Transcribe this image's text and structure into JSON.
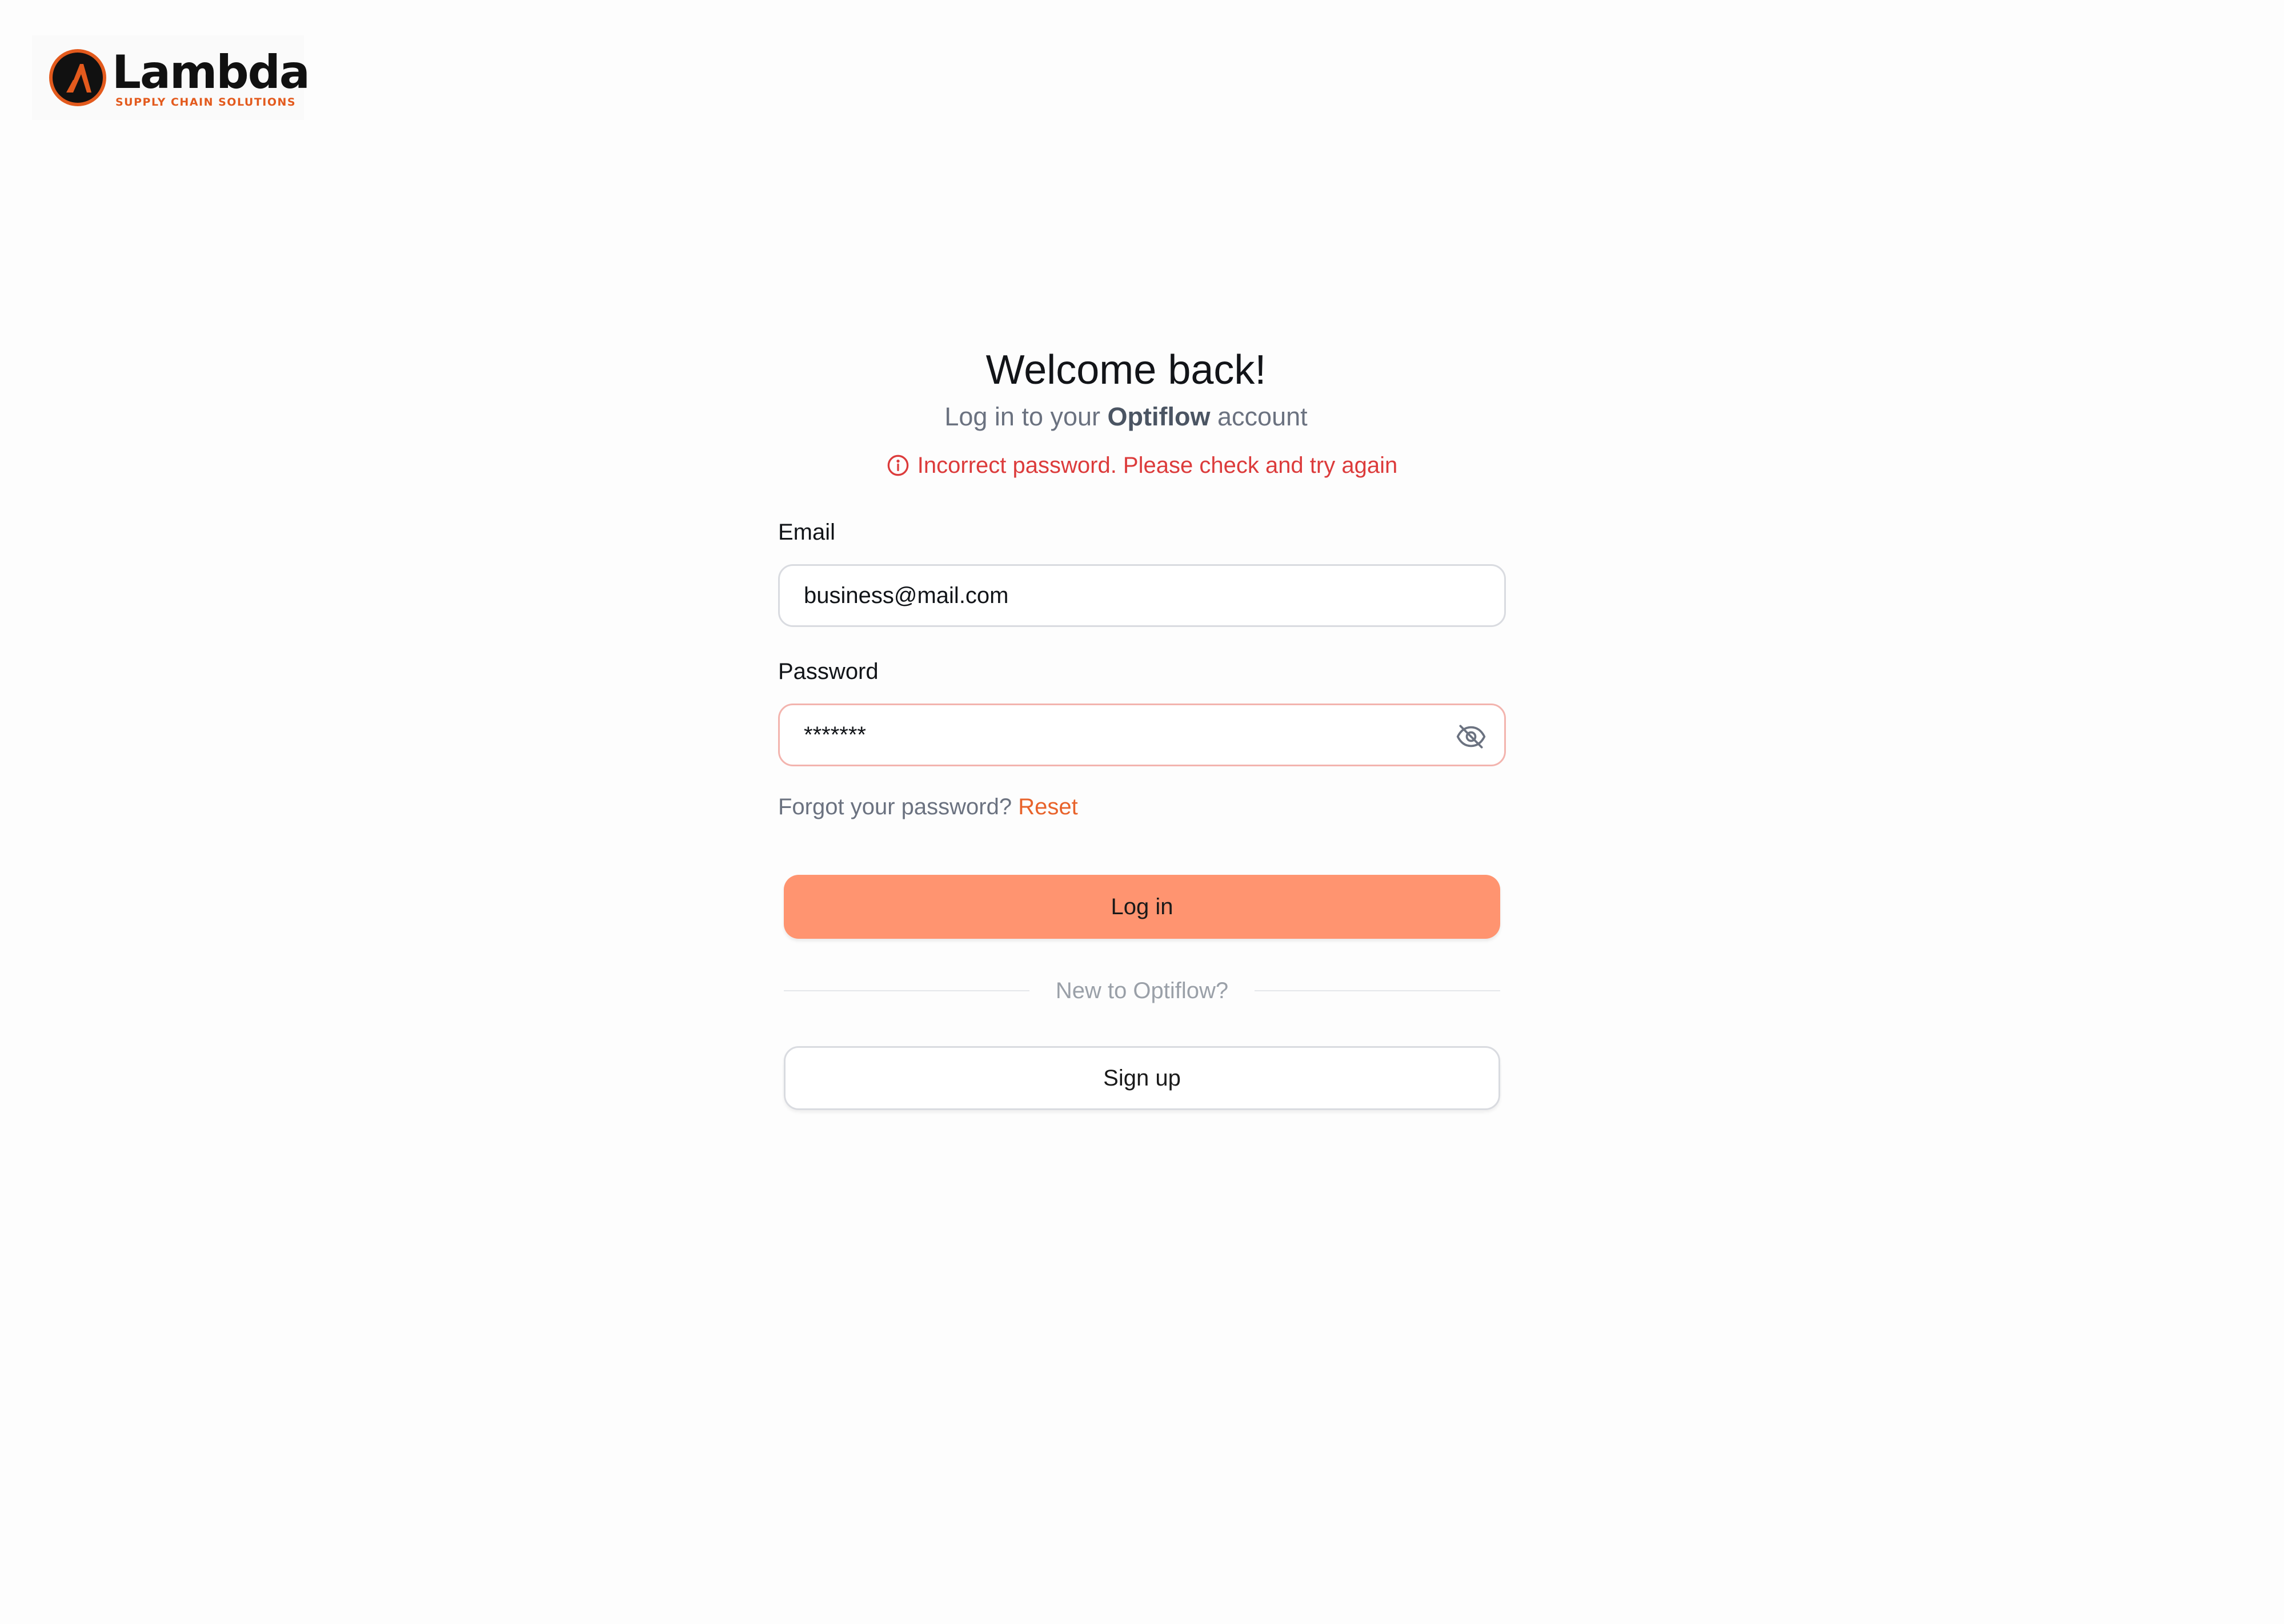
{
  "logo": {
    "word": "Lambda",
    "tagline": "SUPPLY CHAIN SOLUTIONS",
    "icon": "lambda-logo-mark",
    "colors": {
      "ring": "#e35a1d",
      "disc": "#111111",
      "glyph": "#e35a1d"
    }
  },
  "header": {
    "title": "Welcome back!",
    "subtitle_prefix": "Log in to your",
    "subtitle_brand": "Optiflow",
    "subtitle_suffix": "account"
  },
  "error": {
    "icon": "info-circle-icon",
    "message": "Incorrect password. Please check and try again",
    "color": "#dc3b3b"
  },
  "email": {
    "label": "Email",
    "value": "business@mail.com"
  },
  "password": {
    "label": "Password",
    "value": "*******",
    "toggle_icon": "eye-off-icon"
  },
  "forgot": {
    "prompt": "Forgot your password?",
    "link": "Reset"
  },
  "actions": {
    "login_label": "Log in",
    "divider_text": "New to Optiflow?",
    "signup_label": "Sign up"
  },
  "colors": {
    "accent": "#ff9470",
    "link": "#e8632b",
    "error_border": "#f3b4ae"
  }
}
